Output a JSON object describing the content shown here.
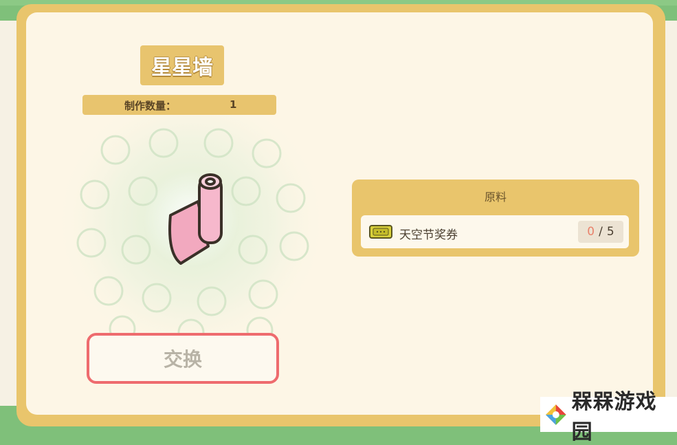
{
  "item": {
    "title": "星星墙",
    "quantity_label": "制作数量：",
    "quantity_value": "1",
    "icon": "pink-wallpaper-roll-icon"
  },
  "exchange_button_label": "交换",
  "materials": {
    "header": "原料",
    "items": [
      {
        "icon": "ticket-icon",
        "name": "天空节奖券",
        "have": "0",
        "separator": "/",
        "need": "5"
      }
    ]
  },
  "watermark": {
    "text": "槑槑游戏园",
    "logo": "watermark-logo"
  },
  "colors": {
    "frame": "#e9c56c",
    "panel_bg": "#fdf6e6",
    "button_border": "#ee6b6e",
    "count_have": "#e9826b",
    "background_green": "#7fc07a"
  }
}
